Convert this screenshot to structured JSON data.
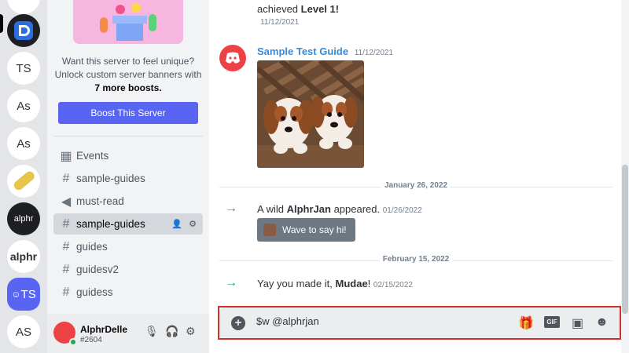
{
  "servers": [
    {
      "label": ""
    },
    {
      "label": ""
    },
    {
      "label": "TS"
    },
    {
      "label": "As"
    },
    {
      "label": "As"
    },
    {
      "label": ""
    },
    {
      "label": "alphr"
    },
    {
      "label": "alphr"
    },
    {
      "label": "TS"
    },
    {
      "label": "AS"
    }
  ],
  "sidebar": {
    "promo_line1": "Want this server to feel unique?",
    "promo_line2": "Unlock custom server banners with",
    "promo_bold": "7 more boosts.",
    "boost_button": "Boost This Server",
    "channels": [
      {
        "label": "Events",
        "icon": "calendar-icon"
      },
      {
        "label": "sample-guides",
        "icon": "hash-icon"
      },
      {
        "label": "must-read",
        "icon": "megaphone-icon"
      },
      {
        "label": "sample-guides",
        "icon": "hash-icon"
      },
      {
        "label": "guides",
        "icon": "hash-icon"
      },
      {
        "label": "guidesv2",
        "icon": "hash-icon"
      },
      {
        "label": "guidess",
        "icon": "hash-icon"
      }
    ]
  },
  "user": {
    "name": "AlphrDelle",
    "tag": "#2604"
  },
  "chat": {
    "top_text": "achieved",
    "top_bold": "Level 1!",
    "top_ts": "11/12/2021",
    "author": "Sample Test Guide",
    "author_ts": "11/12/2021",
    "date1": "January 26, 2022",
    "join_prefix": "A wild",
    "join_user": "AlphrJan",
    "join_suffix": "appeared.",
    "join_ts": "01/26/2022",
    "wave_button": "Wave to say hi!",
    "date2": "February 15, 2022",
    "yay_prefix": "Yay you made it,",
    "yay_user": "Mudae",
    "yay_suffix": "!",
    "yay_ts": "02/15/2022"
  },
  "composer": {
    "value": "$w @alphrjan",
    "gif_label": "GIF"
  },
  "colors": {
    "accent": "#5865f2",
    "highlight": "#d42d2d",
    "link": "#3a8ad6",
    "online": "#23a55a"
  }
}
